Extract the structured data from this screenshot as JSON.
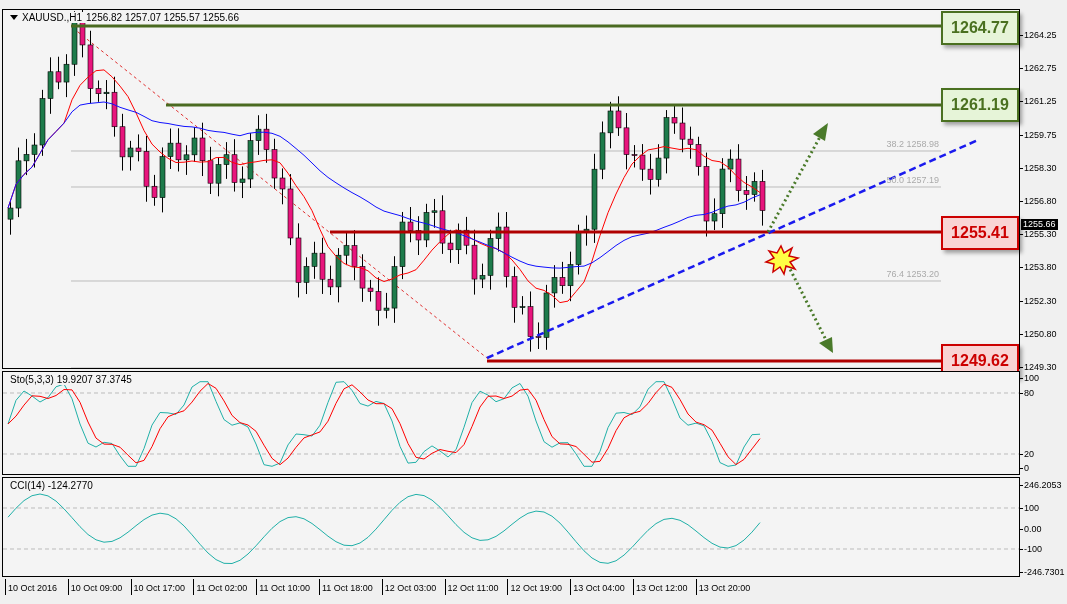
{
  "header": {
    "symbol": "XAUUSD.,H1",
    "quote": "1256.82 1257.07 1255.57 1255.66"
  },
  "price_axis": [
    "1264.25",
    "1262.75",
    "1261.25",
    "1259.75",
    "1258.30",
    "1256.80",
    "1255.30",
    "1253.80",
    "1252.30",
    "1250.80",
    "1249.30"
  ],
  "current_price": "1255.66",
  "levels": [
    {
      "value": "1264.77",
      "kind": "resistance"
    },
    {
      "value": "1261.19",
      "kind": "resistance"
    },
    {
      "value": "1255.41",
      "kind": "support"
    },
    {
      "value": "1249.62",
      "kind": "support"
    }
  ],
  "fib_labels": [
    "38.2 1258.98",
    "50.0 1257.19",
    "76.4 1253.20"
  ],
  "stochastic": {
    "title": "Sto(5,3,3) 19.9207 37.3745",
    "axis": [
      "100",
      "80",
      "20",
      "0"
    ]
  },
  "cci": {
    "title": "CCI(14) -124.2770",
    "axis": [
      "246.2053",
      "100",
      "0.00",
      "-100",
      "-246.7301"
    ]
  },
  "time_axis": [
    "10 Oct 2016",
    "10 Oct 09:00",
    "10 Oct 17:00",
    "11 Oct 02:00",
    "11 Oct 10:00",
    "11 Oct 18:00",
    "12 Oct 03:00",
    "12 Oct 11:00",
    "12 Oct 19:00",
    "13 Oct 04:00",
    "13 Oct 12:00",
    "13 Oct 20:00"
  ]
}
